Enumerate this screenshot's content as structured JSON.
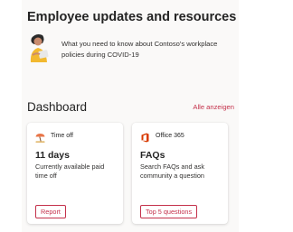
{
  "panel": {
    "title": "Employee updates and resources",
    "background": "#faf9f8"
  },
  "updates": {
    "icon": "person-reading-icon",
    "text": "What you need to know about Contoso's workplace policies during COVID-19"
  },
  "dashboard": {
    "title": "Dashboard",
    "see_all_label": "Alle anzeigen",
    "accent_color": "#c4314b",
    "cards": [
      {
        "icon": "vacation-icon",
        "header": "Time off",
        "headline": "11 days",
        "description": "Currently available paid time off",
        "button_label": "Report"
      },
      {
        "icon": "office365-icon",
        "header": "Office 365",
        "headline": "FAQs",
        "description": "Search FAQs and ask community a question",
        "button_label": "Top 5 questions"
      }
    ]
  }
}
